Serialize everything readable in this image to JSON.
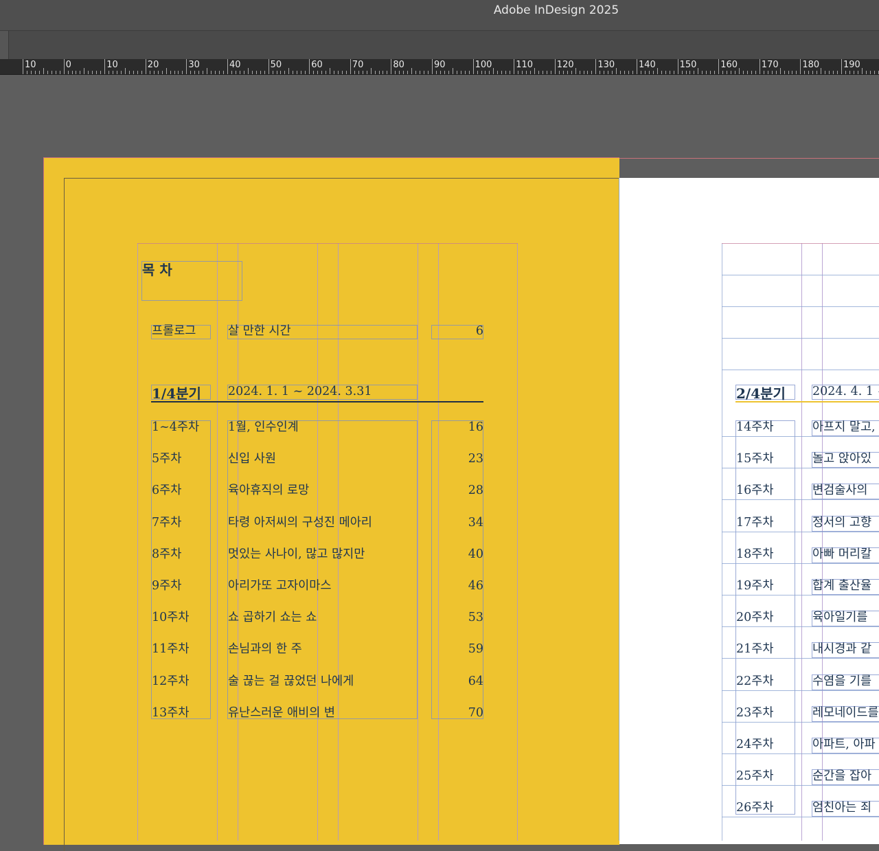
{
  "app": {
    "title": "Adobe InDesign 2025"
  },
  "ruler": {
    "labels": [
      "10",
      "0",
      "10",
      "20",
      "30",
      "40",
      "50",
      "60",
      "70",
      "80",
      "90",
      "100",
      "110",
      "120",
      "130",
      "140",
      "150",
      "160",
      "170",
      "180",
      "190"
    ]
  },
  "colors": {
    "page": "#eec32f",
    "text": "#1e3550",
    "pasteboard": "#5e5e5e"
  },
  "left_page": {
    "heading": "목 차",
    "prologue": {
      "label": "프롤로그",
      "title": "살 만한 시간",
      "page": "6"
    },
    "quarter": {
      "label": "1/4분기",
      "dates": "2024. 1. 1 ~ 2024. 3.31"
    },
    "rows": [
      {
        "week": "1~4주차",
        "title": "1월, 인수인계",
        "page": "16"
      },
      {
        "week": "5주차",
        "title": "신입 사원",
        "page": "23"
      },
      {
        "week": "6주차",
        "title": "육아휴직의 로망",
        "page": "28"
      },
      {
        "week": "7주차",
        "title": "타령 아저씨의 구성진 메아리",
        "page": "34"
      },
      {
        "week": "8주차",
        "title": "멋있는 사나이, 많고 많지만",
        "page": "40"
      },
      {
        "week": "9주차",
        "title": "아리가또 고자이마스",
        "page": "46"
      },
      {
        "week": "10주차",
        "title": "쇼 곱하기 쇼는 쇼",
        "page": "53"
      },
      {
        "week": "11주차",
        "title": "손님과의 한 주",
        "page": "59"
      },
      {
        "week": "12주차",
        "title": "술 끊는 걸 끊었던 나에게",
        "page": "64"
      },
      {
        "week": "13주차",
        "title": "유난스러운 애비의 변",
        "page": "70"
      }
    ]
  },
  "right_page": {
    "quarter": {
      "label": "2/4분기",
      "dates": "2024. 4. 1 ~"
    },
    "rows": [
      {
        "week": "14주차",
        "title": "아프지 말고,"
      },
      {
        "week": "15주차",
        "title": "놀고 앉아있"
      },
      {
        "week": "16주차",
        "title": "변검술사의 "
      },
      {
        "week": "17주차",
        "title": "정서의 고향"
      },
      {
        "week": "18주차",
        "title": "아빠 머리칼"
      },
      {
        "week": "19주차",
        "title": "합계 출산율"
      },
      {
        "week": "20주차",
        "title": "육아일기를 "
      },
      {
        "week": "21주차",
        "title": "내시경과 같"
      },
      {
        "week": "22주차",
        "title": "수염을 기를"
      },
      {
        "week": "23주차",
        "title": "레모네이드를"
      },
      {
        "week": "24주차",
        "title": "아파트, 아파"
      },
      {
        "week": "25주차",
        "title": "순간을 잡아"
      },
      {
        "week": "26주차",
        "title": "엄친아는 죄"
      }
    ]
  }
}
